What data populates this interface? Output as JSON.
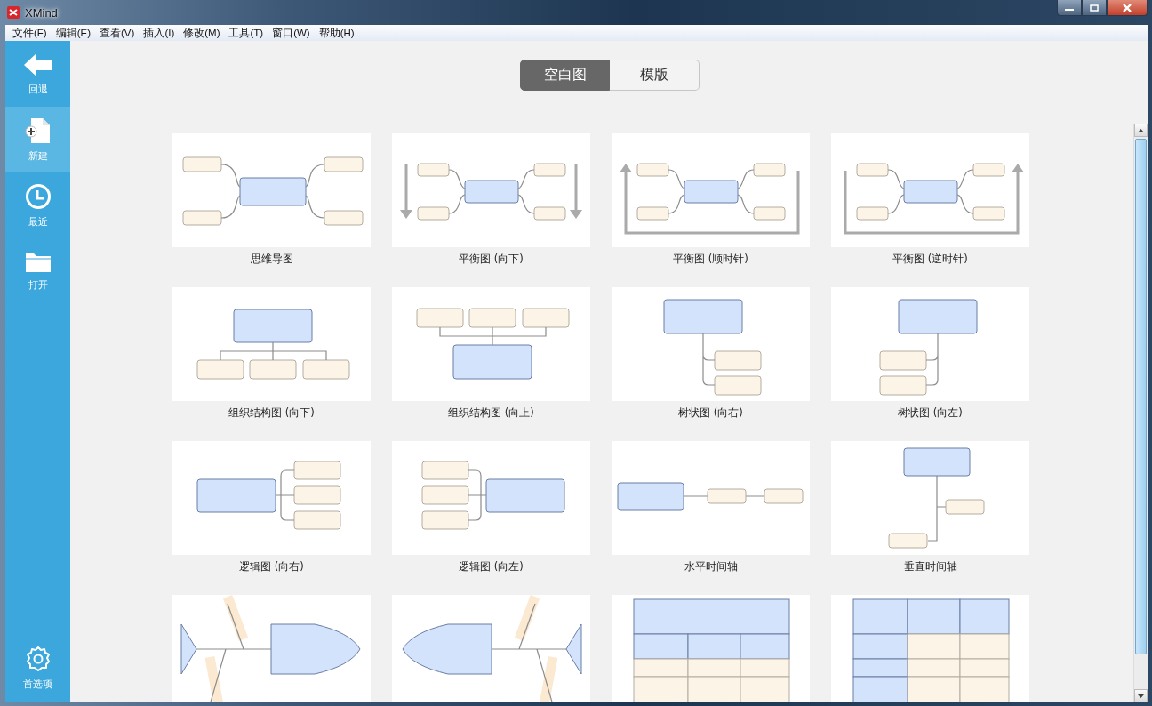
{
  "window": {
    "title": "XMind"
  },
  "menu": [
    {
      "label": "文件(F)"
    },
    {
      "label": "编辑(E)"
    },
    {
      "label": "查看(V)"
    },
    {
      "label": "插入(I)"
    },
    {
      "label": "修改(M)"
    },
    {
      "label": "工具(T)"
    },
    {
      "label": "窗口(W)"
    },
    {
      "label": "帮助(H)"
    }
  ],
  "sidebar": {
    "items": [
      {
        "label": "回退",
        "kind": "back",
        "selected": false
      },
      {
        "label": "新建",
        "kind": "new",
        "selected": true
      },
      {
        "label": "最近",
        "kind": "recent",
        "selected": false
      },
      {
        "label": "打开",
        "kind": "open",
        "selected": false
      }
    ],
    "footer": {
      "label": "首选项",
      "kind": "settings"
    }
  },
  "tabs": [
    {
      "label": "空白图",
      "selected": true
    },
    {
      "label": "模版",
      "selected": false
    }
  ],
  "templates": [
    {
      "label": "思维导图",
      "kind": "mindmap"
    },
    {
      "label": "平衡图 (向下)",
      "kind": "balancedown"
    },
    {
      "label": "平衡图 (顺时针)",
      "kind": "balancecw"
    },
    {
      "label": "平衡图 (逆时针)",
      "kind": "balanceccw"
    },
    {
      "label": "组织结构图 (向下)",
      "kind": "orgdown"
    },
    {
      "label": "组织结构图 (向上)",
      "kind": "orgup"
    },
    {
      "label": "树状图 (向右)",
      "kind": "treeright"
    },
    {
      "label": "树状图 (向左)",
      "kind": "treeleft"
    },
    {
      "label": "逻辑图 (向右)",
      "kind": "logicright"
    },
    {
      "label": "逻辑图 (向左)",
      "kind": "logicleft"
    },
    {
      "label": "水平时间轴",
      "kind": "timelineh"
    },
    {
      "label": "垂直时间轴",
      "kind": "timelinev"
    },
    {
      "kind": "fishboneright"
    },
    {
      "kind": "fishboneleft"
    },
    {
      "kind": "matrixcol"
    },
    {
      "kind": "matrixrow"
    }
  ]
}
